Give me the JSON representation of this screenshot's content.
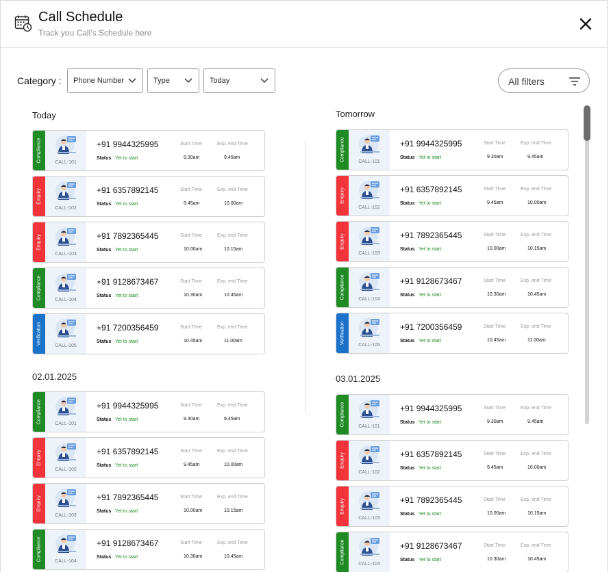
{
  "header": {
    "title": "Call Schedule",
    "subtitle": "Track you Call’s Schedule here",
    "icon": "calendar-clock-icon",
    "close_icon": "close-icon"
  },
  "filters": {
    "category_label": "Category :",
    "phone_number": "Phone Number",
    "type": "Type",
    "date": "Today",
    "all_filters": "All filters"
  },
  "colors": {
    "Compliance": "#1f8b24",
    "Enquiry": "#f2333a",
    "Verification": "#1a73c8",
    "status": "#1f8b24"
  },
  "labels": {
    "status": "Status",
    "start_time": "Start Time",
    "end_time": "Exp. end Time"
  },
  "sections": [
    {
      "title": "Today",
      "calls": [
        {
          "category": "Compliance",
          "call_id": "CALL-101",
          "phone": "+91 9944325995",
          "status": "Yet to start",
          "start": "9.30am",
          "end": "9.45am"
        },
        {
          "category": "Enquiry",
          "call_id": "CALL-102",
          "phone": "+91 6357892145",
          "status": "Yet to start",
          "start": "9.45am",
          "end": "10.00am"
        },
        {
          "category": "Enquiry",
          "call_id": "CALL-103",
          "phone": "+91 7892365445",
          "status": "Yet to start",
          "start": "10.00am",
          "end": "10.15am"
        },
        {
          "category": "Compliance",
          "call_id": "CALL-104",
          "phone": "+91 9128673467",
          "status": "Yet to start",
          "start": "10.30am",
          "end": "10.45am"
        },
        {
          "category": "Verification",
          "call_id": "CALL-105",
          "phone": "+91 7200356459",
          "status": "Yet to start",
          "start": "10.45am",
          "end": "11.00am"
        }
      ]
    },
    {
      "title": "Tomorrow",
      "calls": [
        {
          "category": "Compliance",
          "call_id": "CALL-101",
          "phone": "+91 9944325995",
          "status": "Yet to start",
          "start": "9.30am",
          "end": "9.45am"
        },
        {
          "category": "Enquiry",
          "call_id": "CALL-102",
          "phone": "+91 6357892145",
          "status": "Yet to start",
          "start": "9.45am",
          "end": "10.00am"
        },
        {
          "category": "Enquiry",
          "call_id": "CALL-103",
          "phone": "+91 7892365445",
          "status": "Yet to start",
          "start": "10.00am",
          "end": "10.15am"
        },
        {
          "category": "Compliance",
          "call_id": "CALL-104",
          "phone": "+91 9128673467",
          "status": "Yet to start",
          "start": "10.30am",
          "end": "10.45am"
        },
        {
          "category": "Verification",
          "call_id": "CALL-105",
          "phone": "+91 7200356459",
          "status": "Yet to start",
          "start": "10.45am",
          "end": "11.00am"
        }
      ]
    },
    {
      "title": "02.01.2025",
      "calls": [
        {
          "category": "Compliance",
          "call_id": "CALL-101",
          "phone": "+91 9944325995",
          "status": "Yet to start",
          "start": "9.30am",
          "end": "9.45am"
        },
        {
          "category": "Enquiry",
          "call_id": "CALL-102",
          "phone": "+91 6357892145",
          "status": "Yet to start",
          "start": "9.45am",
          "end": "10.00am"
        },
        {
          "category": "Enquiry",
          "call_id": "CALL-103",
          "phone": "+91 7892365445",
          "status": "Yet to start",
          "start": "10.00am",
          "end": "10.15am"
        },
        {
          "category": "Compliance",
          "call_id": "CALL-104",
          "phone": "+91 9128673467",
          "status": "Yet to start",
          "start": "10.30am",
          "end": "10.45am"
        }
      ]
    },
    {
      "title": "03.01.2025",
      "calls": [
        {
          "category": "Compliance",
          "call_id": "CALL-101",
          "phone": "+91 9944325995",
          "status": "Yet to start",
          "start": "9.30am",
          "end": "9.45am"
        },
        {
          "category": "Enquiry",
          "call_id": "CALL-102",
          "phone": "+91 6357892145",
          "status": "Yet to start",
          "start": "9.45am",
          "end": "10.00am"
        },
        {
          "category": "Enquiry",
          "call_id": "CALL-103",
          "phone": "+91 7892365445",
          "status": "Yet to start",
          "start": "10.00am",
          "end": "10.15am"
        },
        {
          "category": "Compliance",
          "call_id": "CALL-104",
          "phone": "+91 9128673467",
          "status": "Yet to start",
          "start": "10.30am",
          "end": "10.45am"
        }
      ]
    }
  ]
}
